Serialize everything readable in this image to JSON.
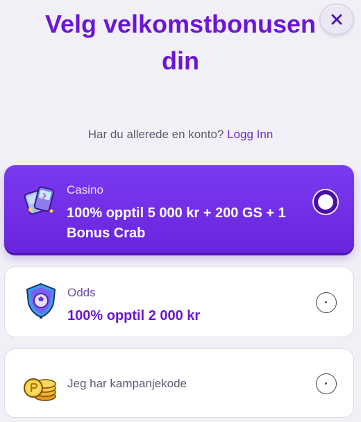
{
  "modal": {
    "title": "Velg velkomstbonusen din",
    "close_icon": "close-icon",
    "login_prompt": "Har du allerede en konto?",
    "login_link": "Logg Inn"
  },
  "options": [
    {
      "label": "Casino",
      "value": "100% opptil 5 000 kr + 200 GS + 1 Bonus Crab",
      "icon": "casino-tickets-icon",
      "selected": true,
      "color": "#6a24de"
    },
    {
      "label": "Odds",
      "value": "100% opptil 2 000 kr",
      "icon": "shield-ball-icon",
      "selected": false
    },
    {
      "label": "Jeg har kampanjekode",
      "icon": "coins-icon",
      "selected": false
    }
  ],
  "colors": {
    "accent": "#6a16d4",
    "background": "#f2f0f7"
  }
}
